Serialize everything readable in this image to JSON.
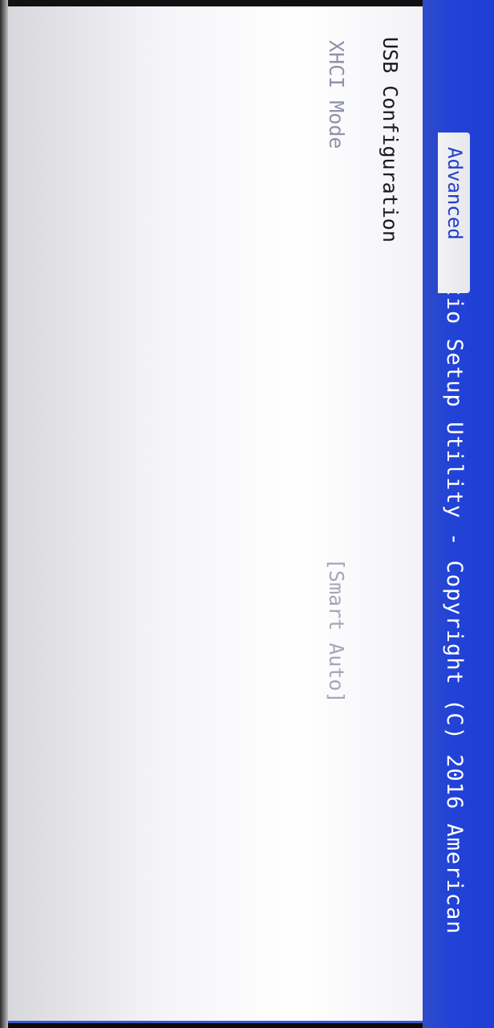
{
  "header": {
    "title": "Aptio Setup Utility - Copyright (C) 2016 American"
  },
  "tabs": {
    "active": "Advanced"
  },
  "content": {
    "section_title": "USB Configuration",
    "settings": [
      {
        "label": "XHCI Mode",
        "value": "[Smart Auto]"
      }
    ]
  },
  "colors": {
    "header_blue": "#2243d6",
    "tab_text_blue": "#233ecb",
    "panel_background": "#f4f3f7"
  }
}
